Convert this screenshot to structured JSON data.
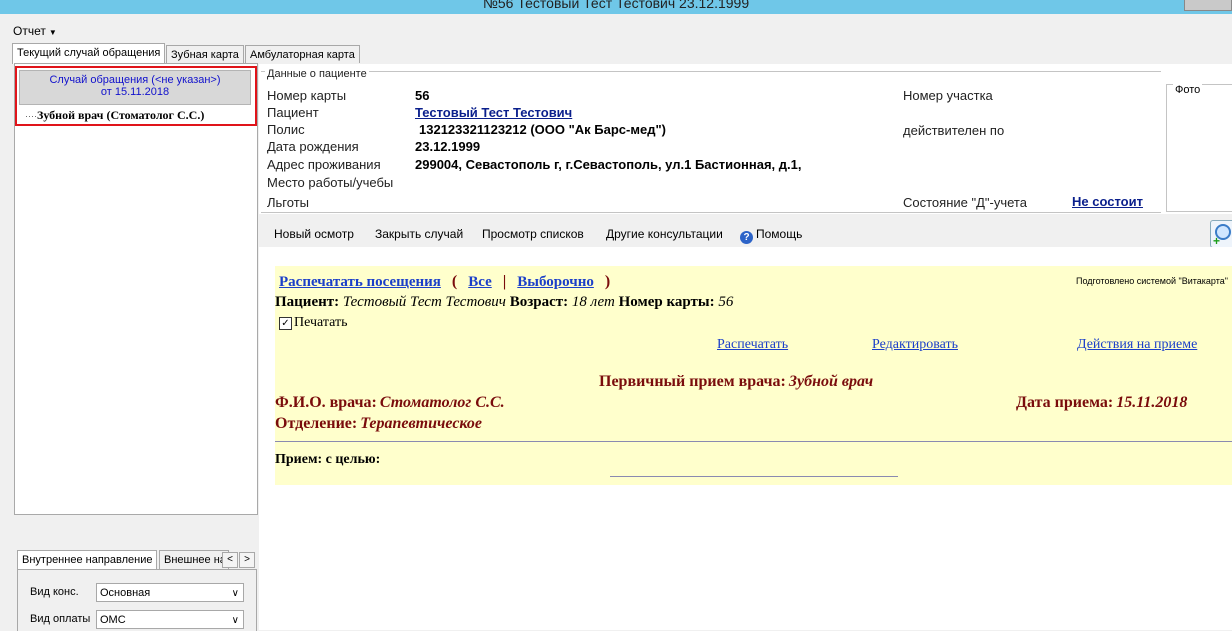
{
  "window": {
    "title": "№56 Тестовый Тест Тестович 23.12.1999"
  },
  "menu": {
    "report": "Отчет"
  },
  "tabs": [
    "Текущий случай обращения",
    "Зубная карта",
    "Амбулаторная карта"
  ],
  "case_tree": {
    "header_line1": "Случай обращения (<не указан>)",
    "header_line2": "от 15.11.2018",
    "item": "Зубной врач (Стоматолог С.С.)"
  },
  "referral": {
    "tabs": [
      "Внутреннее направление",
      "Внешнее на"
    ],
    "scroll_left": "<",
    "scroll_right": ">",
    "fields": [
      {
        "label": "Вид конс.",
        "value": "Основная"
      },
      {
        "label": "Вид оплаты",
        "value": "ОМС"
      }
    ]
  },
  "patient": {
    "section_title": "Данные о пациенте",
    "photo_label": "Фото",
    "card_number_label": "Номер карты",
    "card_number": "56",
    "patient_label": "Пациент",
    "patient_name": "Тестовый Тест Тестович",
    "policy_label": "Полис",
    "policy": "132123321123212 (ООО \"Ак Барс-мед\")",
    "birth_label": "Дата рождения",
    "birth": "23.12.1999",
    "address_label": "Адрес проживания",
    "address": "299004, Севастополь г, г.Севастополь, ул.1 Бастионная, д.1,",
    "work_label": "Место работы/учебы",
    "benefits_label": "Льготы",
    "district_label": "Номер участка",
    "valid_label": "действителен по",
    "dispensary_label": "Состояние \"Д\"-учета",
    "dispensary_value": "Не состоит"
  },
  "toolbar": {
    "new_exam": "Новый осмотр",
    "close_case": "Закрыть случай",
    "view_lists": "Просмотр списков",
    "other_consults": "Другие консультации",
    "help": "Помощь"
  },
  "document": {
    "print_visits": "Распечатать посещения",
    "open_paren": "(",
    "all": "Все",
    "separator": "|",
    "selective": "Выборочно",
    "close_paren": ")",
    "prepared_by": "Подготовлено системой \"Витакарта\"",
    "patient_label": "Пациент:",
    "patient_name": "Тестовый Тест Тестович",
    "age_label": "Возраст:",
    "age": "18 лет",
    "card_label": "Номер карты:",
    "card_number": "56",
    "print_checkbox": "Печатать",
    "print_link": "Распечатать",
    "edit_link": "Редактировать",
    "actions_link": "Действия на приеме",
    "heading_label": "Первичный прием врача:",
    "heading_value": "Зубной врач",
    "doctor_label": "Ф.И.О. врача:",
    "doctor": "Стоматолог С.С.",
    "date_label": "Дата приема:",
    "date": "15.11.2018",
    "department_label": "Отделение:",
    "department": "Терапевтическое",
    "goal_label": "Прием: с целью:"
  }
}
